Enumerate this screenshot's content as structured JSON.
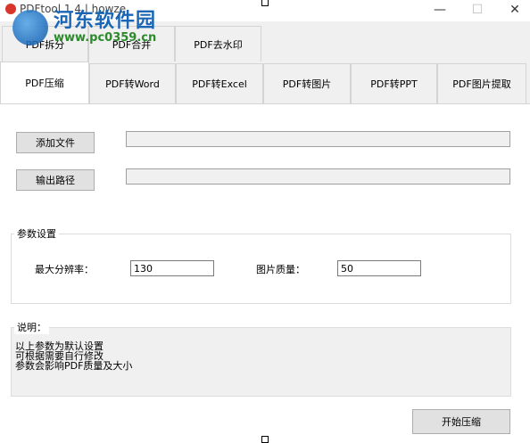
{
  "window": {
    "title": "PDFtool 1.4 | howze",
    "minimize": "—",
    "maximize": "☐",
    "close": "✕"
  },
  "watermark": {
    "main": "河东软件园",
    "url": "www.pc0359.cn"
  },
  "tabs_row1": [
    "PDF拆分",
    "PDF合并",
    "PDF去水印"
  ],
  "tabs_row2": [
    "PDF压缩",
    "PDF转Word",
    "PDF转Excel",
    "PDF转图片",
    "PDF转PPT",
    "PDF图片提取"
  ],
  "file": {
    "add_button": "添加文件",
    "output_button": "输出路径",
    "file_path": "",
    "output_path": ""
  },
  "params": {
    "title": "参数设置",
    "max_resolution_label": "最大分辨率：",
    "max_resolution_value": "130",
    "image_quality_label": "图片质量：",
    "image_quality_value": "50"
  },
  "notes": {
    "title": "说明：",
    "lines": [
      "以上参数为默认设置",
      "可根据需要自行修改",
      "参数会影响PDF质量及大小"
    ]
  },
  "start_button": "开始压缩"
}
